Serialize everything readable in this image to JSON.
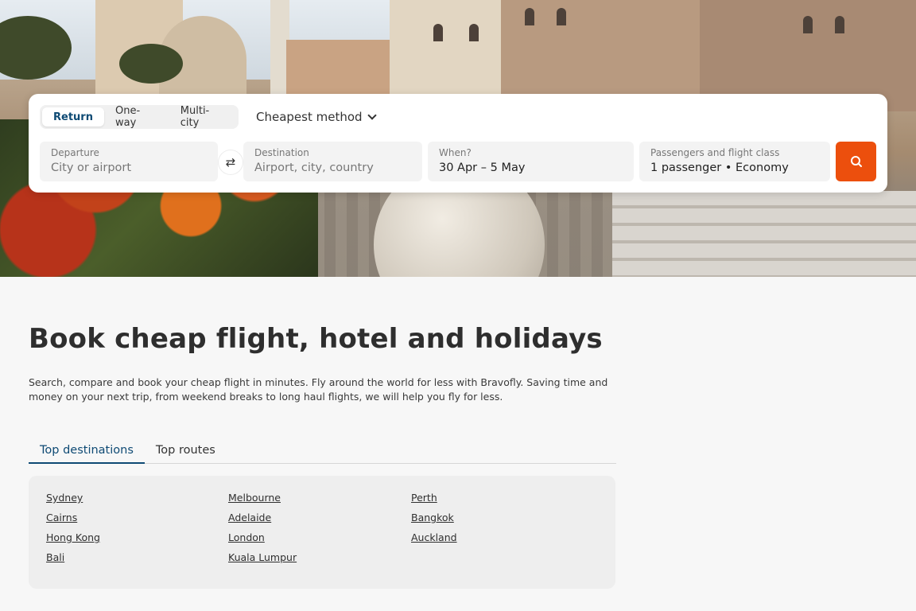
{
  "search": {
    "trip_types": [
      "Return",
      "One-way",
      "Multi-city"
    ],
    "selected_trip_type": "Return",
    "method_label": "Cheapest method",
    "departure": {
      "label": "Departure",
      "placeholder": "City or airport"
    },
    "destination": {
      "label": "Destination",
      "placeholder": "Airport, city, country"
    },
    "when": {
      "label": "When?",
      "value": "30 Apr – 5 May"
    },
    "passengers": {
      "label": "Passengers and flight class",
      "value": "1 passenger • Economy"
    }
  },
  "content": {
    "headline": "Book cheap flight, hotel and holidays",
    "intro": "Search, compare and book your cheap flight in minutes. Fly around the world for less with Bravofly. Saving time and money on your next trip, from weekend breaks to long haul flights, we will help you fly for less."
  },
  "tabs": [
    "Top destinations",
    "Top routes"
  ],
  "destinations": {
    "col1": [
      "Sydney",
      "Cairns",
      "Hong Kong",
      "Bali"
    ],
    "col2": [
      "Melbourne",
      "Adelaide",
      "London",
      "Kuala Lumpur"
    ],
    "col3": [
      "Perth",
      "Bangkok",
      "Auckland"
    ]
  },
  "colors": {
    "accent": "#ec4f0d",
    "brand": "#0e4a74"
  },
  "icons": {
    "swap": "swap-arrows-icon",
    "search": "search-icon",
    "chevron": "chevron-down-icon"
  }
}
